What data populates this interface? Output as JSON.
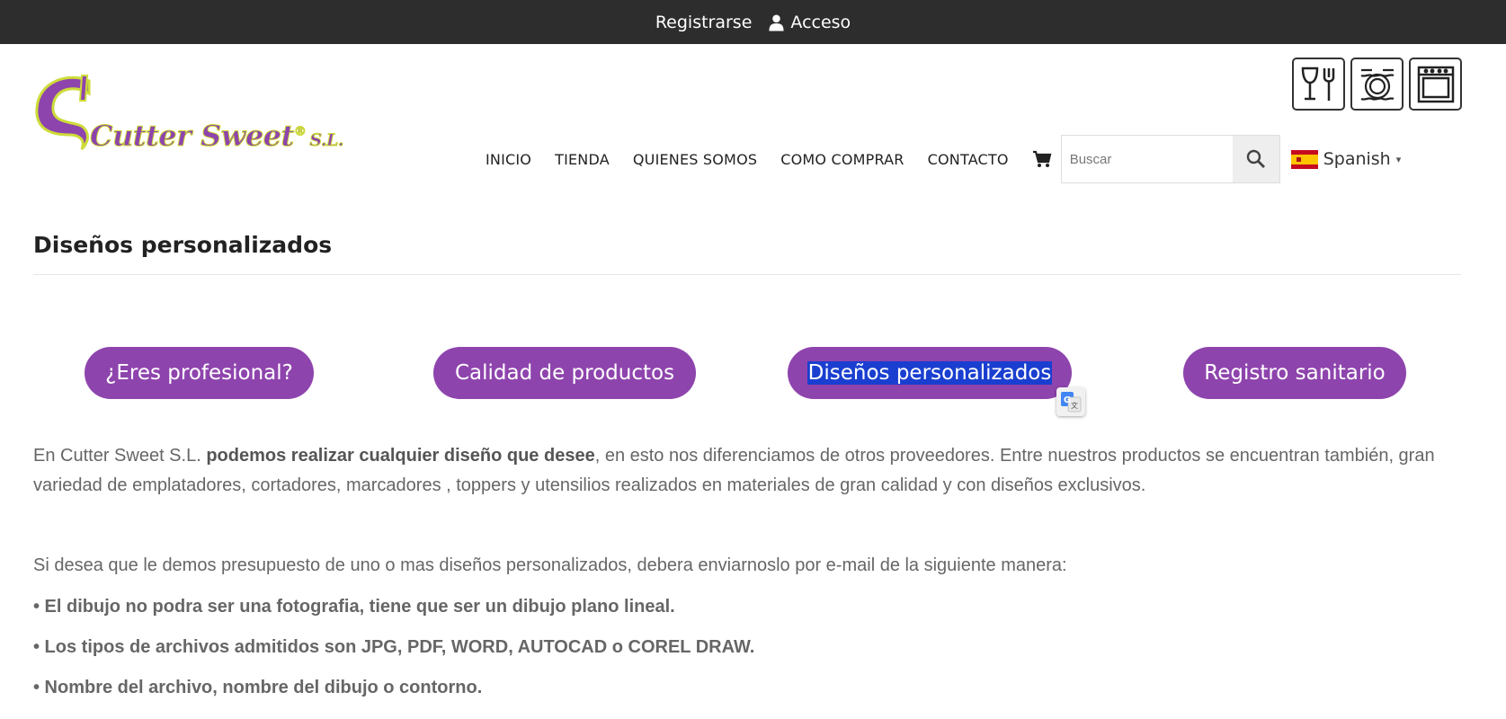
{
  "topbar": {
    "register_label": "Registrarse",
    "login_label": "Acceso",
    "login_icon": "user-icon"
  },
  "logo": {
    "brand": "Cutter Sweet",
    "suffix": "S.L.",
    "initial": "C",
    "registered": "®"
  },
  "badges": [
    {
      "icon": "glass-fork-icon"
    },
    {
      "icon": "dishwasher-icon"
    },
    {
      "icon": "oven-icon"
    }
  ],
  "nav": {
    "items": [
      "INICIO",
      "TIENDA",
      "QUIENES SOMOS",
      "COMO COMPRAR",
      "CONTACTO"
    ],
    "cart_icon": "cart-icon"
  },
  "search": {
    "placeholder": "Buscar",
    "value": "",
    "icon": "search-icon"
  },
  "language": {
    "label": "Spanish",
    "flag": "spain-flag-icon",
    "caret": "▾"
  },
  "page": {
    "title": "Diseños personalizados"
  },
  "pills": [
    "¿Eres profesional?",
    "Calidad de productos",
    "Diseños personalizados",
    "Registro sanitario"
  ],
  "content": {
    "p1_prefix": "En Cutter Sweet S.L. ",
    "p1_bold": "podemos realizar cualquier diseño que desee",
    "p1_suffix": ", en esto nos diferenciamos de otros proveedores. Entre nuestros productos se encuentran también, gran variedad de emplatadores, cortadores, marcadores , toppers y utensilios realizados en materiales de gran calidad y con diseños exclusivos.",
    "p2": "Si desea que le demos presupuesto de uno o mas diseños personalizados, debera enviarnoslo por e-mail de la siguiente manera:",
    "bullets": [
      "• El dibujo no podra ser una fotografia, tiene que ser un dibujo plano lineal.",
      "• Los tipos de archivos admitidos son JPG, PDF, WORD, AUTOCAD o COREL DRAW.",
      "• Nombre del archivo, nombre del dibujo o contorno."
    ]
  },
  "colors": {
    "brand_purple": "#8e44ad",
    "topbar_bg": "#2d2d2d",
    "highlight": "#1a3fd0"
  }
}
